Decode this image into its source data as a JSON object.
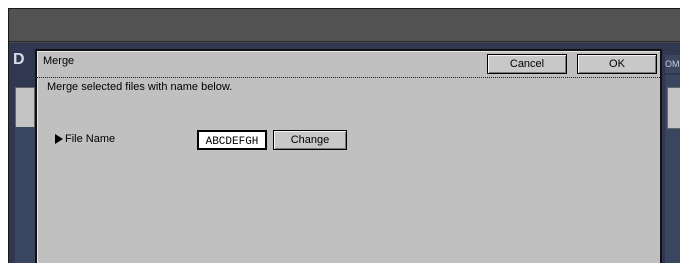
{
  "dialog": {
    "title": "Merge",
    "cancel_label": "Cancel",
    "ok_label": "OK",
    "message": "Merge selected files with name below.",
    "file_name_label": "File Name",
    "file_name_value": "ABCDEFGH",
    "change_label": "Change"
  },
  "background": {
    "left_letter": "D",
    "right_text": "OM"
  },
  "icons": {
    "row_marker": "triangle-right-icon"
  }
}
